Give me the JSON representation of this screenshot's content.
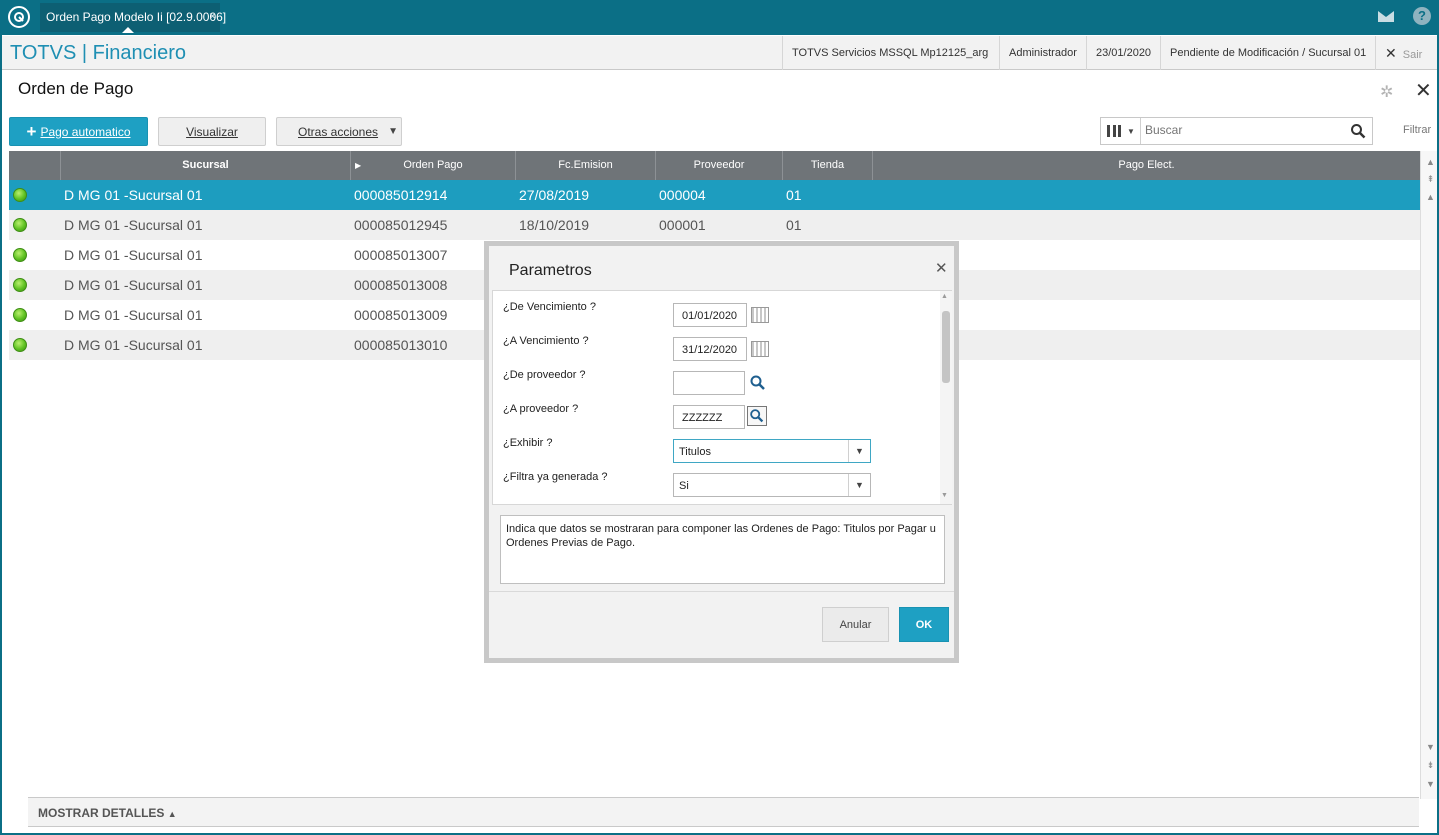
{
  "topbar": {
    "tab_title": "Orden Pago Modelo Ii [02.9.0006]",
    "tab_close": "×",
    "icons": [
      "app-logo-icon",
      "mail-icon",
      "help-icon"
    ],
    "help_glyph": "?"
  },
  "header": {
    "brand": "TOTVS | Financiero",
    "environment": "TOTVS Servicios MSSQL Mp12125_arg",
    "user": "Administrador",
    "date": "23/01/2020",
    "branch_status": "Pendiente de Modificación / Sucursal 01",
    "exit_label": "Sair"
  },
  "page": {
    "title": "Orden de Pago"
  },
  "toolbar": {
    "primary_label": "Pago automatico",
    "visualizar_label": "Visualizar",
    "otras_label": "Otras acciones",
    "search_placeholder": "Buscar",
    "filter_label": "Filtrar"
  },
  "grid": {
    "columns": [
      "",
      "Sucursal",
      "Orden Pago",
      "Fc.Emision",
      "Proveedor",
      "Tienda",
      "Pago Elect."
    ],
    "rows": [
      {
        "status": "active",
        "sucursal": "D MG 01 -Sucursal 01",
        "orden": "000085012914",
        "emision": "27/08/2019",
        "proveedor": "000004",
        "tienda": "01"
      },
      {
        "status": "active",
        "sucursal": "D MG 01 -Sucursal 01",
        "orden": "000085012945",
        "emision": "18/10/2019",
        "proveedor": "000001",
        "tienda": "01"
      },
      {
        "status": "active",
        "sucursal": "D MG 01 -Sucursal 01",
        "orden": "000085013007",
        "emision": "",
        "proveedor": "",
        "tienda": ""
      },
      {
        "status": "active",
        "sucursal": "D MG 01 -Sucursal 01",
        "orden": "000085013008",
        "emision": "",
        "proveedor": "",
        "tienda": ""
      },
      {
        "status": "active",
        "sucursal": "D MG 01 -Sucursal 01",
        "orden": "000085013009",
        "emision": "",
        "proveedor": "",
        "tienda": ""
      },
      {
        "status": "active",
        "sucursal": "D MG 01 -Sucursal 01",
        "orden": "000085013010",
        "emision": "",
        "proveedor": "",
        "tienda": ""
      }
    ]
  },
  "detail_bar": {
    "label": "MOSTRAR DETALLES"
  },
  "modal": {
    "title": "Parametros",
    "params": [
      {
        "label": "¿De Vencimiento ?",
        "value": "01/01/2020",
        "kind": "date"
      },
      {
        "label": "¿A Vencimiento ?",
        "value": "31/12/2020",
        "kind": "date"
      },
      {
        "label": "¿De proveedor ?",
        "value": "",
        "kind": "lookup"
      },
      {
        "label": "¿A proveedor ?",
        "value": "ZZZZZZ",
        "kind": "lookup"
      },
      {
        "label": "¿Exhibir ?",
        "value": "Titulos",
        "kind": "select"
      },
      {
        "label": "¿Filtra ya generada ?",
        "value": "Si",
        "kind": "select"
      }
    ],
    "help_text": "Indica que datos se mostraran para componer las Ordenes de Pago: Titulos por Pagar u Ordenes Previas de Pago.",
    "cancel_label": "Anular",
    "ok_label": "OK"
  },
  "colors": {
    "topbar": "#0b6f86",
    "accent": "#1ea0c3",
    "selected_row": "#1d9dbf",
    "grid_header": "#6f7478",
    "status_ok": "#5fc222"
  }
}
